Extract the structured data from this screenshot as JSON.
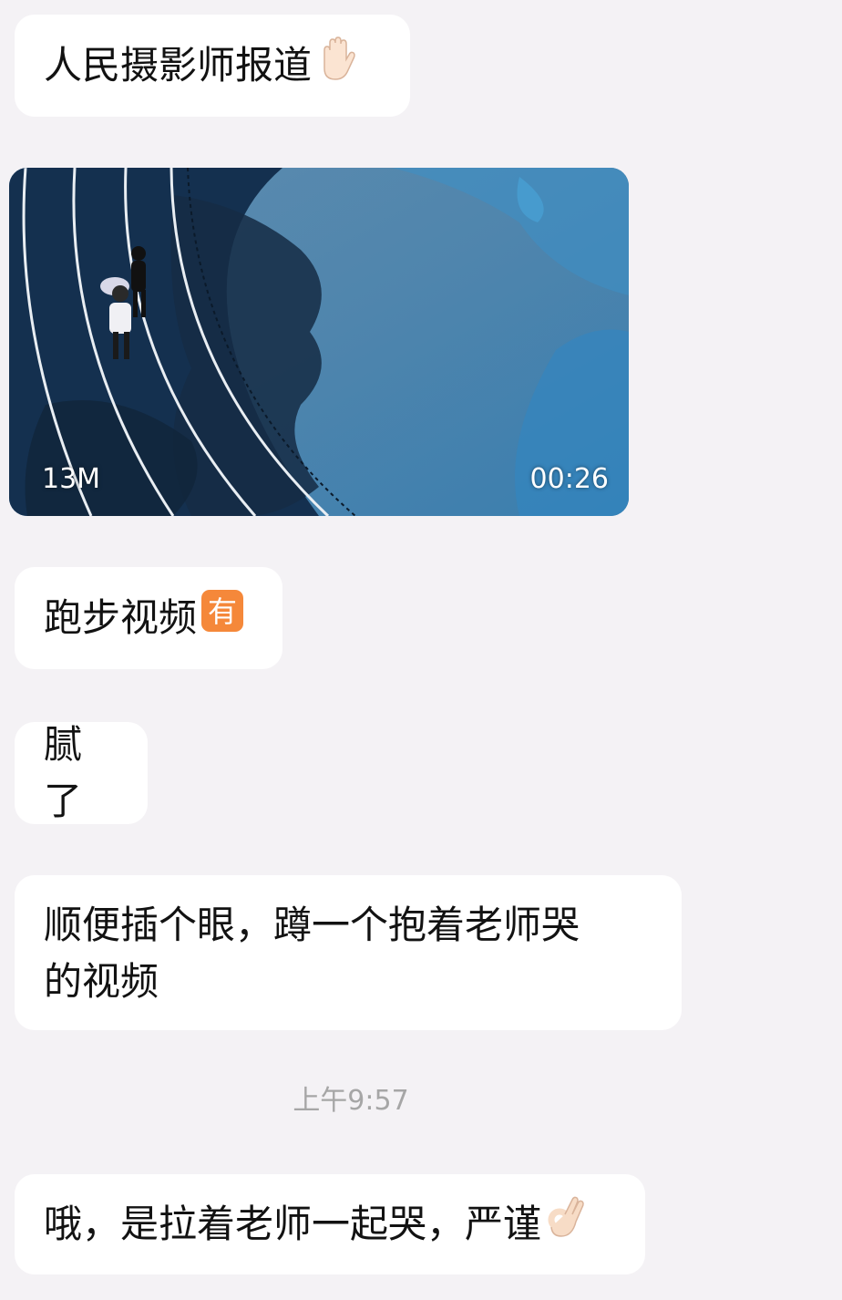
{
  "messages": [
    {
      "text": "人民摄影师报道",
      "emoji": "raised-hand-icon"
    },
    {
      "video": {
        "size": "13M",
        "duration": "00:26"
      }
    },
    {
      "text": "跑步视频",
      "emoji": "you-badge-icon",
      "badge_char": "有"
    },
    {
      "text": "腻了"
    },
    {
      "text": "顺便插个眼，蹲一个抱着老师哭\n的视频"
    },
    {
      "timestamp": "上午9:57"
    },
    {
      "text": "哦，是拉着老师一起哭，严谨",
      "emoji": "ok-hand-icon"
    }
  ],
  "colors": {
    "background": "#f4f2f5",
    "bubble": "#ffffff",
    "text": "#121212",
    "timestamp": "#a6a6a6",
    "badge": "#f5883a"
  }
}
